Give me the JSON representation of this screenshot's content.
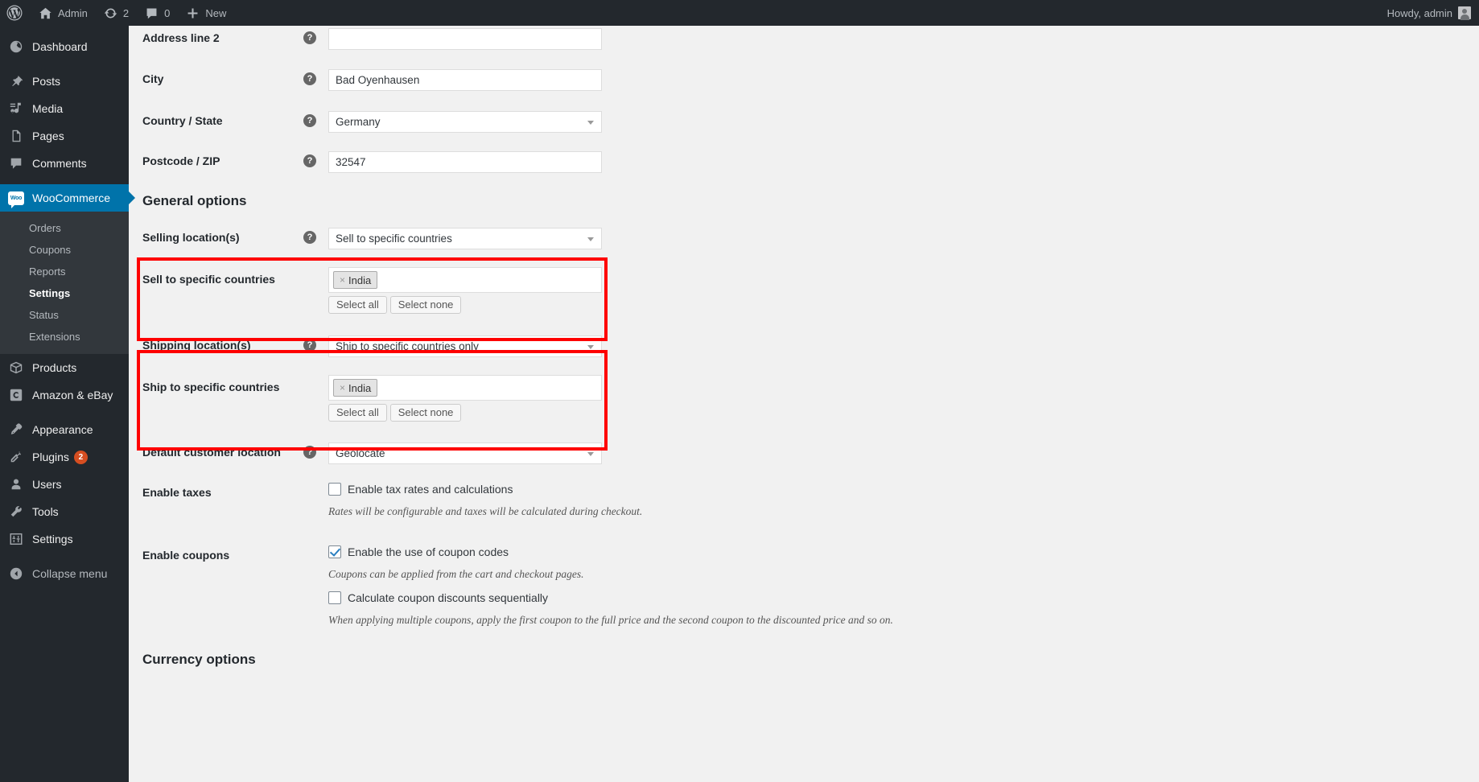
{
  "adminbar": {
    "logo_icon": "wordpress-logo-icon",
    "site_name": "Admin",
    "home_icon": "home-icon",
    "updates_icon": "updates-icon",
    "updates_count": "2",
    "comments_icon": "comments-icon",
    "comments_count": "0",
    "new_icon": "plus-icon",
    "new_label": "New",
    "howdy": "Howdy, admin",
    "avatar_icon": "avatar-icon"
  },
  "sidebar": {
    "items": [
      {
        "label": "Dashboard",
        "icon": "dashboard-icon"
      },
      {
        "label": "Posts",
        "icon": "pin-icon"
      },
      {
        "label": "Media",
        "icon": "media-icon"
      },
      {
        "label": "Pages",
        "icon": "pages-icon"
      },
      {
        "label": "Comments",
        "icon": "comment-icon"
      },
      {
        "label": "WooCommerce",
        "icon": "woocommerce-icon"
      },
      {
        "label": "Products",
        "icon": "box-icon"
      },
      {
        "label": "Amazon & eBay",
        "icon": "amazon-ebay-icon"
      },
      {
        "label": "Appearance",
        "icon": "brush-icon"
      },
      {
        "label": "Plugins",
        "icon": "plug-icon",
        "badge": "2"
      },
      {
        "label": "Users",
        "icon": "user-icon"
      },
      {
        "label": "Tools",
        "icon": "wrench-icon"
      },
      {
        "label": "Settings",
        "icon": "sliders-icon"
      },
      {
        "label": "Collapse menu",
        "icon": "collapse-arrow-icon"
      }
    ],
    "woocommerce_submenu": [
      {
        "label": "Orders",
        "active": false
      },
      {
        "label": "Coupons",
        "active": false
      },
      {
        "label": "Reports",
        "active": false
      },
      {
        "label": "Settings",
        "active": true
      },
      {
        "label": "Status",
        "active": false
      },
      {
        "label": "Extensions",
        "active": false
      }
    ]
  },
  "form": {
    "address_line_2": {
      "label": "Address line 2",
      "value": "",
      "help_icon": "help-icon"
    },
    "city": {
      "label": "City",
      "value": "Bad Oyenhausen",
      "help_icon": "help-icon"
    },
    "country_state": {
      "label": "Country / State",
      "value": "Germany",
      "help_icon": "help-icon"
    },
    "postcode": {
      "label": "Postcode / ZIP",
      "value": "32547",
      "help_icon": "help-icon"
    },
    "general_options_heading": "General options",
    "selling_locations": {
      "label": "Selling location(s)",
      "value": "Sell to specific countries",
      "help_icon": "help-icon"
    },
    "sell_to_specific": {
      "label": "Sell to specific countries",
      "tags": [
        "India"
      ],
      "tag_remove_glyph": "×",
      "select_all": "Select all",
      "select_none": "Select none"
    },
    "shipping_locations": {
      "label": "Shipping location(s)",
      "value": "Ship to specific countries only",
      "help_icon": "help-icon"
    },
    "ship_to_specific": {
      "label": "Ship to specific countries",
      "tags": [
        "India"
      ],
      "tag_remove_glyph": "×",
      "select_all": "Select all",
      "select_none": "Select none"
    },
    "default_customer_location": {
      "label": "Default customer location",
      "value": "Geolocate",
      "help_icon": "help-icon"
    },
    "enable_taxes": {
      "label": "Enable taxes",
      "checkbox_label": "Enable tax rates and calculations",
      "checked": false,
      "description": "Rates will be configurable and taxes will be calculated during checkout."
    },
    "enable_coupons": {
      "label": "Enable coupons",
      "checkbox_label": "Enable the use of coupon codes",
      "checked": true,
      "description": "Coupons can be applied from the cart and checkout pages.",
      "checkbox2_label": "Calculate coupon discounts sequentially",
      "checked2": false,
      "description2": "When applying multiple coupons, apply the first coupon to the full price and the second coupon to the discounted price and so on."
    },
    "currency_options_heading": "Currency options"
  },
  "annotations": {
    "highlight_color": "#fe0000",
    "boxes": [
      {
        "name": "sell-to-specific-countries-highlight"
      },
      {
        "name": "shipping-locations-highlight"
      }
    ]
  }
}
